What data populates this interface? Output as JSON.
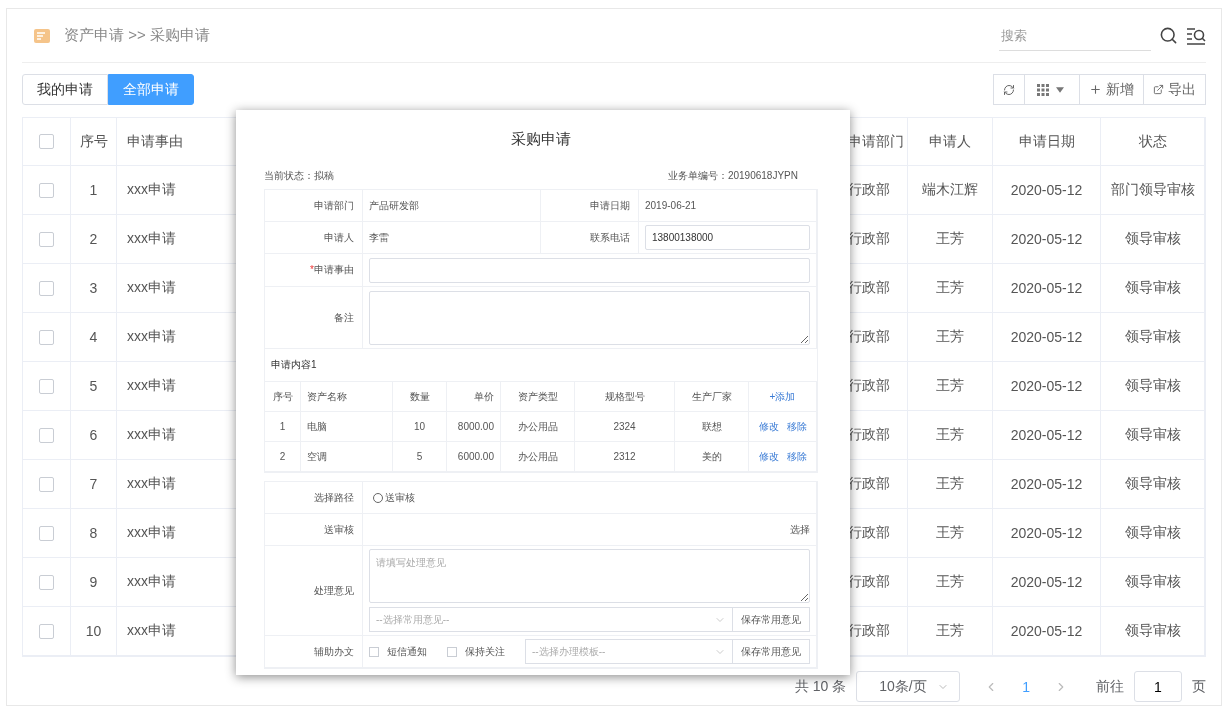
{
  "breadcrumb": {
    "text": "资产申请 >> 采购申请"
  },
  "search": {
    "placeholder": "搜索"
  },
  "view_tabs": [
    {
      "label": "我的申请",
      "selected": false
    },
    {
      "label": "全部申请",
      "selected": true
    }
  ],
  "toolbar": [
    {
      "kind": "refresh"
    },
    {
      "kind": "columns"
    },
    {
      "kind": "add",
      "label": "新增"
    },
    {
      "kind": "export",
      "label": "导出"
    }
  ],
  "table": {
    "all_checked": false,
    "columns": [
      "序号",
      "申请事由",
      "申请部门",
      "申请人",
      "申请日期",
      "状态"
    ],
    "rows": [
      {
        "checked": false,
        "cells": [
          "1",
          "xxx申请",
          "行政部",
          "端木江辉",
          "2020-05-12",
          "部门领导审核"
        ]
      },
      {
        "checked": false,
        "cells": [
          "2",
          "xxx申请",
          "行政部",
          "王芳",
          "2020-05-12",
          "领导审核"
        ]
      },
      {
        "checked": false,
        "cells": [
          "3",
          "xxx申请",
          "行政部",
          "王芳",
          "2020-05-12",
          "领导审核"
        ]
      },
      {
        "checked": false,
        "cells": [
          "4",
          "xxx申请",
          "行政部",
          "王芳",
          "2020-05-12",
          "领导审核"
        ]
      },
      {
        "checked": false,
        "cells": [
          "5",
          "xxx申请",
          "行政部",
          "王芳",
          "2020-05-12",
          "领导审核"
        ]
      },
      {
        "checked": false,
        "cells": [
          "6",
          "xxx申请",
          "行政部",
          "王芳",
          "2020-05-12",
          "领导审核"
        ]
      },
      {
        "checked": false,
        "cells": [
          "7",
          "xxx申请",
          "行政部",
          "王芳",
          "2020-05-12",
          "领导审核"
        ]
      },
      {
        "checked": false,
        "cells": [
          "8",
          "xxx申请",
          "行政部",
          "王芳",
          "2020-05-12",
          "领导审核"
        ]
      },
      {
        "checked": false,
        "cells": [
          "9",
          "xxx申请",
          "行政部",
          "王芳",
          "2020-05-12",
          "领导审核"
        ]
      },
      {
        "checked": false,
        "cells": [
          "10",
          "xxx申请",
          "行政部",
          "王芳",
          "2020-05-12",
          "领导审核"
        ]
      }
    ]
  },
  "pagination": {
    "total": "共 10 条",
    "page_size": "10条/页",
    "pages": [
      {
        "label": "1",
        "selected": true
      }
    ],
    "goto_label": "前往",
    "goto_value": "1",
    "goto_suffix": "页"
  },
  "dialog": {
    "title": "采购申请",
    "status": "当前状态：拟稿",
    "number": "业务单编号：20190618JYPN",
    "info_rows": [
      [
        {
          "label": "申请部门",
          "value": "产品研发部",
          "kind": "text"
        },
        {
          "label": "申请日期",
          "value": "2019-06-21",
          "kind": "text"
        }
      ],
      [
        {
          "label": "申请人",
          "value": "李雷",
          "kind": "text"
        },
        {
          "label": "联系电话",
          "value": "13800138000",
          "kind": "input"
        }
      ]
    ],
    "reason": {
      "label": "申请事由",
      "required_mark": "*"
    },
    "remark": {
      "label": "备注"
    },
    "items": {
      "title": "申请内容1",
      "columns": [
        "序号",
        "资产名称",
        "数量",
        "单价",
        "资产类型",
        "规格型号",
        "生产厂家"
      ],
      "add_label": "+添加",
      "rows": [
        {
          "cells": [
            "1",
            "电脑",
            "10",
            "8000.00",
            "办公用品",
            "2324",
            "联想"
          ],
          "actions": [
            "修改",
            "移除"
          ]
        },
        {
          "cells": [
            "2",
            "空调",
            "5",
            "6000.00",
            "办公用品",
            "2312",
            "美的"
          ],
          "actions": [
            "修改",
            "移除"
          ]
        }
      ]
    },
    "route": {
      "label": "选择路径",
      "options": [
        {
          "label": "送审核",
          "selected": false
        }
      ]
    },
    "reviewer": {
      "label": "送审核",
      "action": "选择"
    },
    "opinion": {
      "label": "处理意见",
      "placeholder": "请填写处理意见",
      "select_placeholder": "--选择常用意见--",
      "save": "保存常用意见"
    },
    "assist": {
      "label": "辅助办文",
      "checks": [
        {
          "label": "短信通知",
          "checked": false
        },
        {
          "label": "保持关注",
          "checked": false
        }
      ],
      "select_placeholder": "--选择办理模板--",
      "save": "保存常用意见"
    }
  }
}
